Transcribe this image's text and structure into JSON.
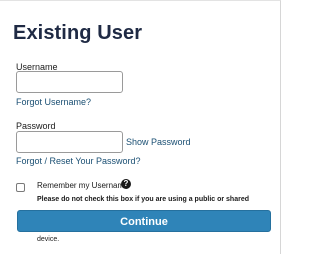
{
  "page": {
    "title": "Existing User"
  },
  "username": {
    "label": "Username",
    "value": "",
    "forgot_link": "Forgot Username?"
  },
  "password": {
    "label": "Password",
    "value": "",
    "show_link": "Show Password",
    "forgot_link": "Forgot / Reset Your Password?"
  },
  "remember": {
    "label": "Remember my Username",
    "checked": false,
    "help_icon": "?",
    "warning": "Please do not check this box if you are using a public or shared",
    "warning_tail": "device."
  },
  "actions": {
    "continue_label": "Continue"
  },
  "colors": {
    "title": "#1f2a44",
    "link": "#1a4f73",
    "button": "#2f84b8"
  }
}
